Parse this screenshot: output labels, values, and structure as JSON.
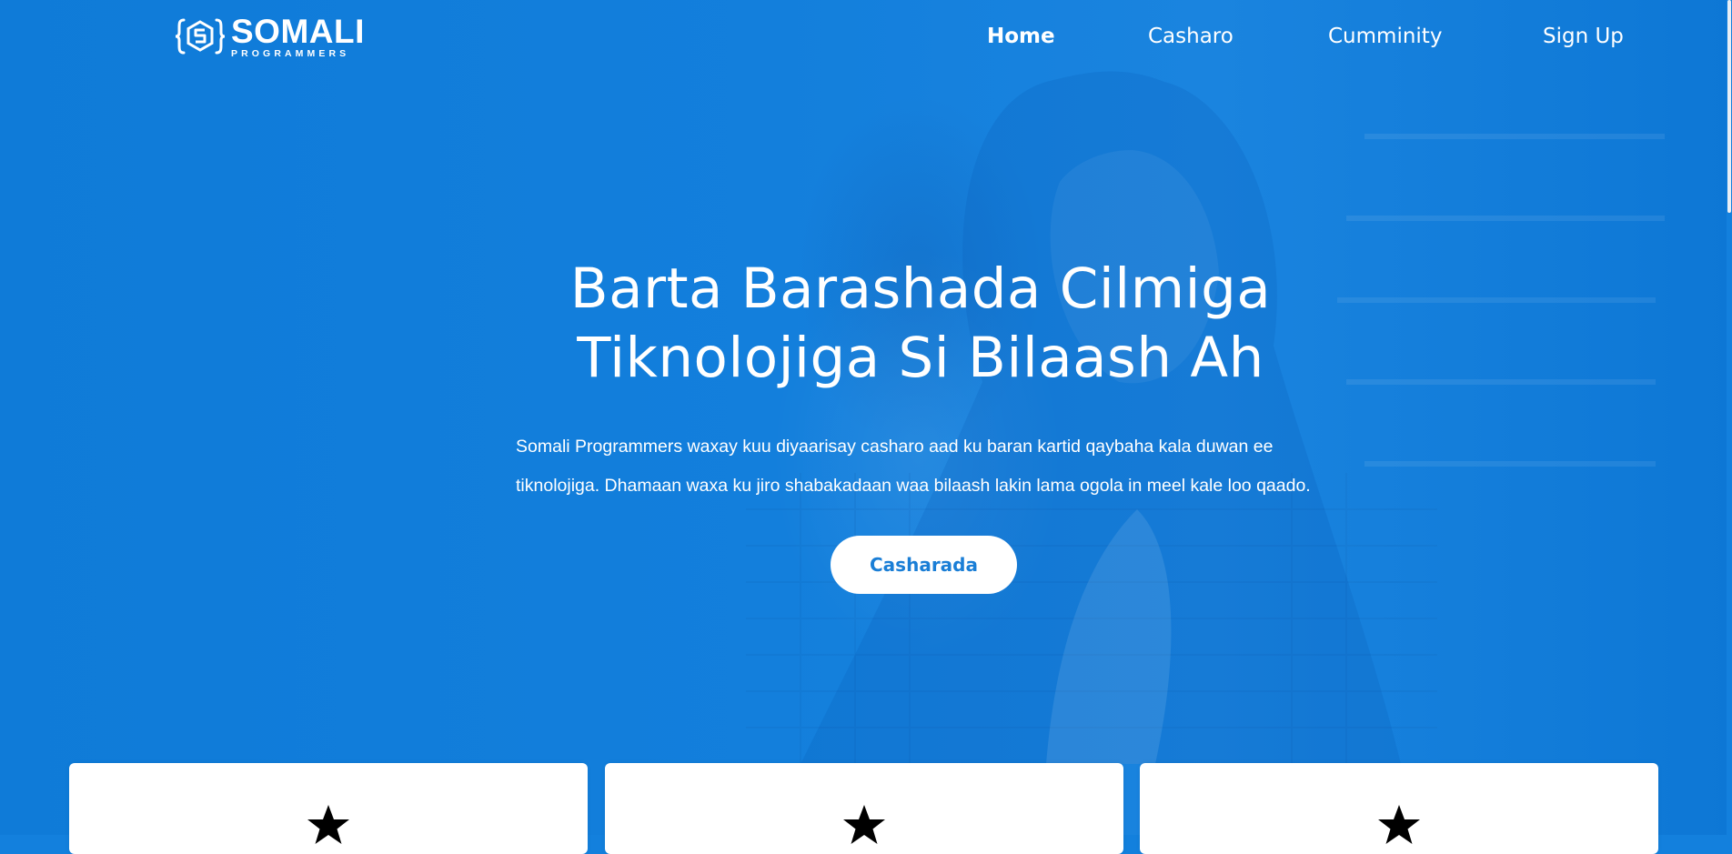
{
  "brand": {
    "name": "SOMALI",
    "tagline": "PROGRAMMERS"
  },
  "nav": {
    "items": [
      {
        "label": "Home",
        "active": true
      },
      {
        "label": "Casharo",
        "active": false
      },
      {
        "label": "Cumminity",
        "active": false
      },
      {
        "label": "Sign Up",
        "active": false
      }
    ]
  },
  "hero": {
    "title_line1": "Barta Barashada Cilmiga",
    "title_line2": "Tiknolojiga Si Bilaash Ah",
    "desc_line1": "Somali Programmers waxay kuu diyaarisay casharo aad ku baran kartid qaybaha kala duwan ee",
    "desc_line2": "tiknolojiga. Dhamaan waxa ku jiro shabakadaan waa bilaash lakin lama ogola in meel kale loo qaado.",
    "cta_label": "Casharada"
  },
  "cards": [
    {
      "icon": "star-icon"
    },
    {
      "icon": "star-icon"
    },
    {
      "icon": "star-icon"
    }
  ],
  "colors": {
    "hero_blue": "#1380dd",
    "cta_text": "#1a7ed6",
    "card_bg": "#ffffff"
  }
}
